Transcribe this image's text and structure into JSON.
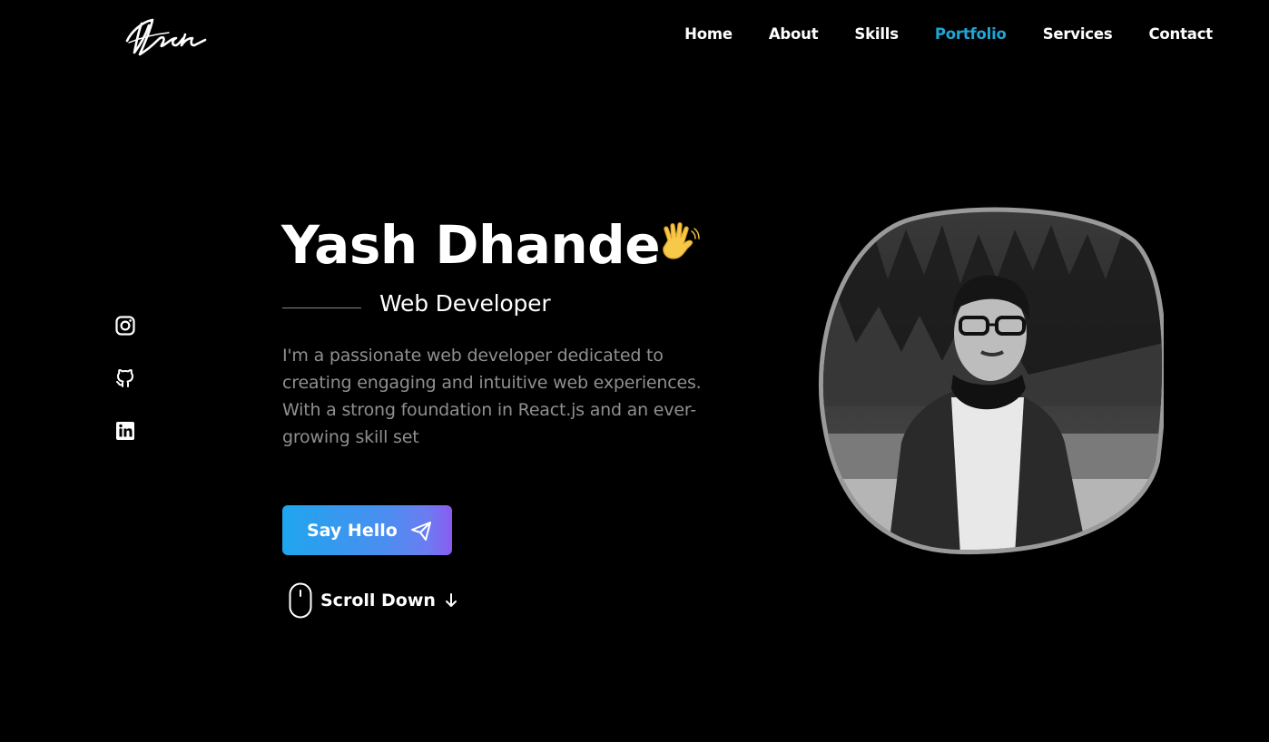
{
  "header": {
    "logo_text": "Yash",
    "nav": [
      {
        "label": "Home",
        "active": false
      },
      {
        "label": "About",
        "active": false
      },
      {
        "label": "Skills",
        "active": false
      },
      {
        "label": "Portfolio",
        "active": true
      },
      {
        "label": "Services",
        "active": false
      },
      {
        "label": "Contact",
        "active": false
      }
    ]
  },
  "social": [
    {
      "icon": "instagram-icon"
    },
    {
      "icon": "github-icon"
    },
    {
      "icon": "linkedin-icon"
    }
  ],
  "hero": {
    "name": "Yash Dhande",
    "wave_icon": "waving-hand-icon",
    "role": "Web Developer",
    "description": "I'm a passionate web developer dedicated to creating engaging and intuitive web experiences. With a strong foundation in React.js and an ever-growing skill set",
    "cta_label": "Say Hello",
    "cta_icon": "send-icon",
    "scroll_label": "Scroll Down",
    "scroll_icon": "mouse-icon",
    "scroll_arrow_icon": "arrow-down-icon"
  },
  "colors": {
    "background": "#000000",
    "accent": "#1fa6d4",
    "button_gradient_start": "#1fa6ee",
    "button_gradient_end": "#8a5cf0",
    "muted_text": "#8f8f8f"
  }
}
